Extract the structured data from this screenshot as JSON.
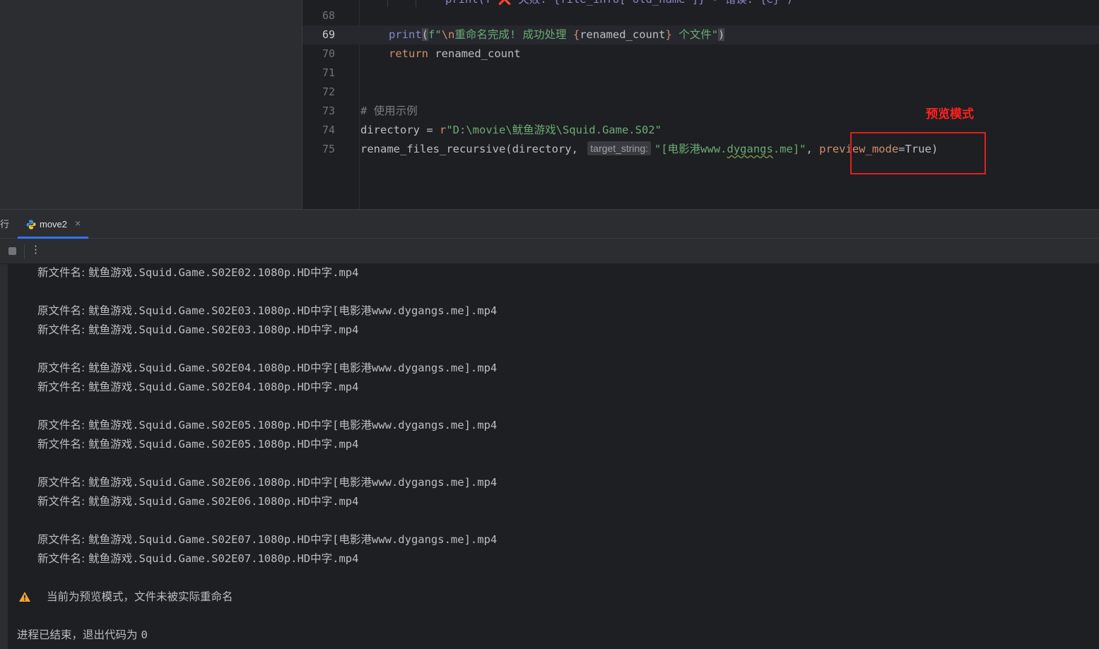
{
  "editor": {
    "lines": [
      {
        "num": "68"
      },
      {
        "num": "69"
      },
      {
        "num": "70"
      },
      {
        "num": "71"
      },
      {
        "num": "72"
      },
      {
        "num": "73"
      },
      {
        "num": "74"
      },
      {
        "num": "75"
      }
    ],
    "partial_top": "print(f\"❌ 失败: {file_info['old_name']} - 错误: {e}\")",
    "l69": {
      "print": "print",
      "open": "(",
      "f": "f\"",
      "esc": "\\n",
      "text1": "重命名完成! 成功处理 ",
      "b1": "{",
      "var": "renamed_count",
      "b2": "}",
      "text2": " 个文件\"",
      "close": ")"
    },
    "l70": {
      "kw": "return",
      "rest": " renamed_count"
    },
    "l73": {
      "comment": "# 使用示例"
    },
    "l74": {
      "var": "directory = ",
      "prefix": "r",
      "str": "\"D:\\movie\\鱿鱼游戏\\Squid.Game.S02\""
    },
    "l75": {
      "call": "rename_files_recursive(directory, ",
      "hint": "target_string:",
      "str1": "\"[电影港www.",
      "squiggle": "dygangs",
      "str2": ".me]\"",
      "comma": ", ",
      "param": "preview_mode",
      "eq": "=True)"
    },
    "annotation": "预览模式"
  },
  "toolwindow": {
    "run_label": "行",
    "tab_label": "move2",
    "tab_close": "×",
    "more": "⋮"
  },
  "console": {
    "rows": [
      {
        "label": "新文件名: ",
        "value": "鱿鱼游戏.Squid.Game.S02E02.1080p.HD中字.mp4"
      },
      {
        "label": "原文件名: ",
        "value": "鱿鱼游戏.Squid.Game.S02E03.1080p.HD中字[电影港www.dygangs.me].mp4"
      },
      {
        "label": "新文件名: ",
        "value": "鱿鱼游戏.Squid.Game.S02E03.1080p.HD中字.mp4"
      },
      {
        "label": "原文件名: ",
        "value": "鱿鱼游戏.Squid.Game.S02E04.1080p.HD中字[电影港www.dygangs.me].mp4"
      },
      {
        "label": "新文件名: ",
        "value": "鱿鱼游戏.Squid.Game.S02E04.1080p.HD中字.mp4"
      },
      {
        "label": "原文件名: ",
        "value": "鱿鱼游戏.Squid.Game.S02E05.1080p.HD中字[电影港www.dygangs.me].mp4"
      },
      {
        "label": "新文件名: ",
        "value": "鱿鱼游戏.Squid.Game.S02E05.1080p.HD中字.mp4"
      },
      {
        "label": "原文件名: ",
        "value": "鱿鱼游戏.Squid.Game.S02E06.1080p.HD中字[电影港www.dygangs.me].mp4"
      },
      {
        "label": "新文件名: ",
        "value": "鱿鱼游戏.Squid.Game.S02E06.1080p.HD中字.mp4"
      },
      {
        "label": "原文件名: ",
        "value": "鱿鱼游戏.Squid.Game.S02E07.1080p.HD中字[电影港www.dygangs.me].mp4"
      },
      {
        "label": "新文件名: ",
        "value": "鱿鱼游戏.Squid.Game.S02E07.1080p.HD中字.mp4"
      }
    ],
    "warning": "当前为预览模式，文件未被实际重命名",
    "exit_label": "进程已结束，退出代码为 ",
    "exit_code": "0"
  },
  "colors": {
    "accent": "#3574f0",
    "annotation": "#e02020",
    "warning": "#f0a732"
  }
}
